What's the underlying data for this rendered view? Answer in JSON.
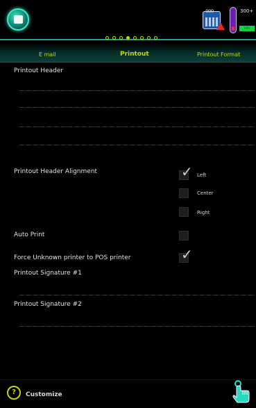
{
  "header": {
    "battery_count_label": "300+",
    "status_pill_label": "ON",
    "accent_color": "#c3d800",
    "teal_color": "#1aa68e",
    "icons": [
      "app-logo-icon",
      "calendar-icon",
      "warning-icon",
      "battery-icon"
    ]
  },
  "pager": {
    "total": 8,
    "active_index": 3
  },
  "tabs": [
    {
      "label": "E mail",
      "active": false
    },
    {
      "label": "Printout",
      "active": true
    },
    {
      "label": "Printout Format",
      "active": false
    }
  ],
  "printout_header": {
    "label": "Printout Header"
  },
  "alignment": {
    "label": "Printout Header Alignment",
    "options": [
      {
        "label": "Left",
        "checked": true
      },
      {
        "label": "Center",
        "checked": false
      },
      {
        "label": "Right",
        "checked": false
      }
    ]
  },
  "auto_print": {
    "label": "Auto Print",
    "checked": false
  },
  "force_unknown": {
    "label": "Force Unknown printer to POS printer",
    "checked": true
  },
  "signature1": {
    "label": "Printout Signature #1"
  },
  "signature2": {
    "label": "Printout Signature #2"
  },
  "footer": {
    "customize_label": "Customize",
    "help_icon": "?"
  }
}
